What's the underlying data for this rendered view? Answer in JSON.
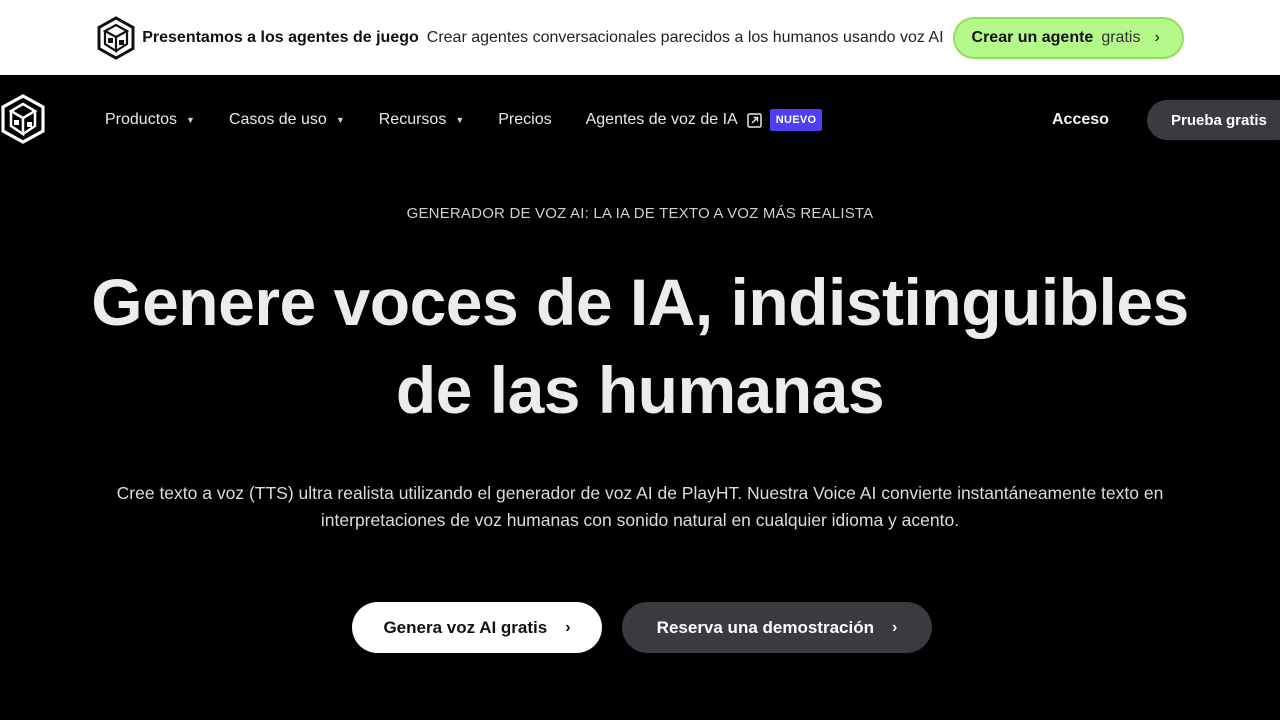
{
  "announcement": {
    "title": "Presentamos a los agentes de juego",
    "text": "Crear agentes conversacionales parecidos a los humanos usando voz AI",
    "button_strong": "Crear un agente",
    "button_light": "gratis",
    "button_chevron": "›",
    "logo_icon": "playht-logo-icon"
  },
  "nav": {
    "items": [
      {
        "label": "Productos",
        "caret": "▼"
      },
      {
        "label": "Casos de uso",
        "caret": "▼"
      },
      {
        "label": "Recursos",
        "caret": "▼"
      },
      {
        "label": "Precios"
      },
      {
        "label": "Agentes de voz de IA",
        "icon": "external-link-icon",
        "badge": "NUEVO"
      }
    ],
    "login": "Acceso",
    "cta": "Prueba gratis",
    "badge_color": "#4f3ff0"
  },
  "hero": {
    "eyebrow": "GENERADOR DE VOZ AI: LA IA DE TEXTO A VOZ MÁS REALISTA",
    "headline_line1": "Genere voces de IA, indistinguibles",
    "headline_line2": "de las humanas",
    "subtitle_line1": "Cree texto a voz (TTS) ultra realista utilizando el generador de voz AI de PlayHT. Nuestra Voice AI convierte instantáneamente texto en",
    "subtitle_line2": "interpretaciones de voz humanas con sonido natural en cualquier idioma y acento.",
    "primary_button": "Genera voz AI gratis",
    "secondary_button": "Reserva una demostración",
    "chevron": "›"
  },
  "colors": {
    "accent_green": "#b4f98a",
    "background": "#000000",
    "secondary_button": "#3a3b40"
  }
}
